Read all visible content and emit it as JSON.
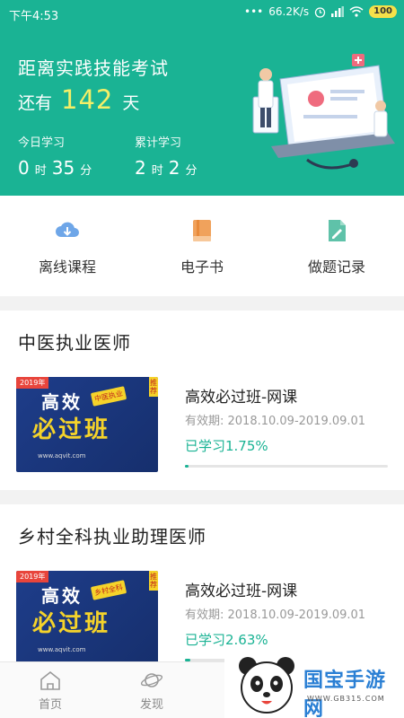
{
  "status_bar": {
    "time": "下午4:53",
    "network_speed": "66.2K/s",
    "battery": "100"
  },
  "hero": {
    "exam_title": "距离实践技能考试",
    "remain_prefix": "还有",
    "remain_days": "142",
    "remain_suffix": "天",
    "today_label": "今日学习",
    "today_hours": "0",
    "today_minutes": "35",
    "total_label": "累计学习",
    "total_hours": "2",
    "total_minutes": "2",
    "hour_unit": "时",
    "minute_unit": "分"
  },
  "actions": [
    {
      "label": "离线课程",
      "icon": "cloud-download-icon"
    },
    {
      "label": "电子书",
      "icon": "book-icon"
    },
    {
      "label": "做题记录",
      "icon": "exercise-record-icon"
    }
  ],
  "sections": [
    {
      "title": "中医执业医师",
      "course": {
        "name": "高效必过班-网课",
        "valid": "有效期: 2018.10.09-2019.09.01",
        "progress_text": "已学习1.75%",
        "progress": 0.0175,
        "thumb": {
          "year": "2019年",
          "line1": "高效",
          "line2": "必过班",
          "tag": "中医执业",
          "recommend": "推荐",
          "site": "www.aqvit.com"
        }
      }
    },
    {
      "title": "乡村全科执业助理医师",
      "course": {
        "name": "高效必过班-网课",
        "valid": "有效期: 2018.10.09-2019.09.01",
        "progress_text": "已学习2.63%",
        "progress": 0.0263,
        "thumb": {
          "year": "2019年",
          "line1": "高效",
          "line2": "必过班",
          "tag": "乡村全科",
          "recommend": "推荐",
          "site": "www.aqvit.com"
        }
      }
    }
  ],
  "bottom_nav": [
    {
      "label": "首页",
      "icon": "home-icon"
    },
    {
      "label": "发现",
      "icon": "planet-icon"
    }
  ],
  "watermark": {
    "name": "国宝手游网",
    "url": "WWW.GB315.COM"
  },
  "colors": {
    "brand": "#1ab394",
    "highlight": "#f4ef67"
  }
}
